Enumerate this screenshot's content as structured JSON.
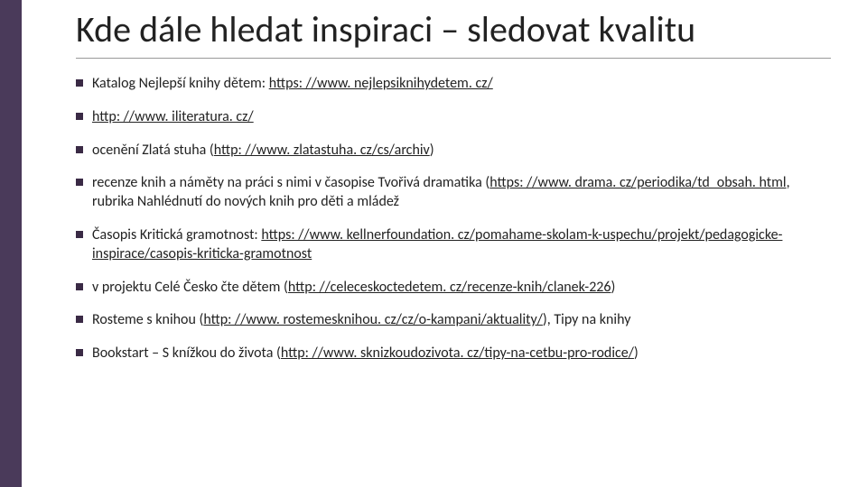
{
  "title": "Kde dále hledat inspiraci – sledovat kvalitu",
  "bullets": [
    {
      "pre": "Katalog Nejlepší knihy dětem: ",
      "link": "https: //www. nejlepsiknihydetem. cz/",
      "post": ""
    },
    {
      "pre": "",
      "link": "http: //www. iliteratura. cz/",
      "post": ""
    },
    {
      "pre": "ocenění Zlatá stuha (",
      "link": "http: //www. zlatastuha. cz/cs/archiv",
      "post": ")"
    },
    {
      "pre": "recenze knih a náměty na práci s nimi v časopise Tvořivá dramatika (",
      "link": "https: //www. drama. cz/periodika/td_obsah. html",
      "post": ", rubrika Nahlédnutí do nových knih pro děti a mládež"
    },
    {
      "pre": "Časopis Kritická gramotnost: ",
      "link": "https: //www. kellnerfoundation. cz/pomahame-skolam-k-uspechu/projekt/pedagogicke-inspirace/casopis-kriticka-gramotnost",
      "post": ""
    },
    {
      "pre": "v projektu Celé Česko čte dětem (",
      "link": "http: //celeceskoctedetem. cz/recenze-knih/clanek-226",
      "post": ")"
    },
    {
      "pre": "Rosteme s knihou (",
      "link": "http: //www. rostemesknihou. cz/cz/o-kampani/aktuality/",
      "post": "), Tipy na knihy"
    },
    {
      "pre": "Bookstart – S knížkou do života (",
      "link": "http: //www. sknizkoudozivota. cz/tipy-na-cetbu-pro-rodice/",
      "post": ")"
    }
  ]
}
